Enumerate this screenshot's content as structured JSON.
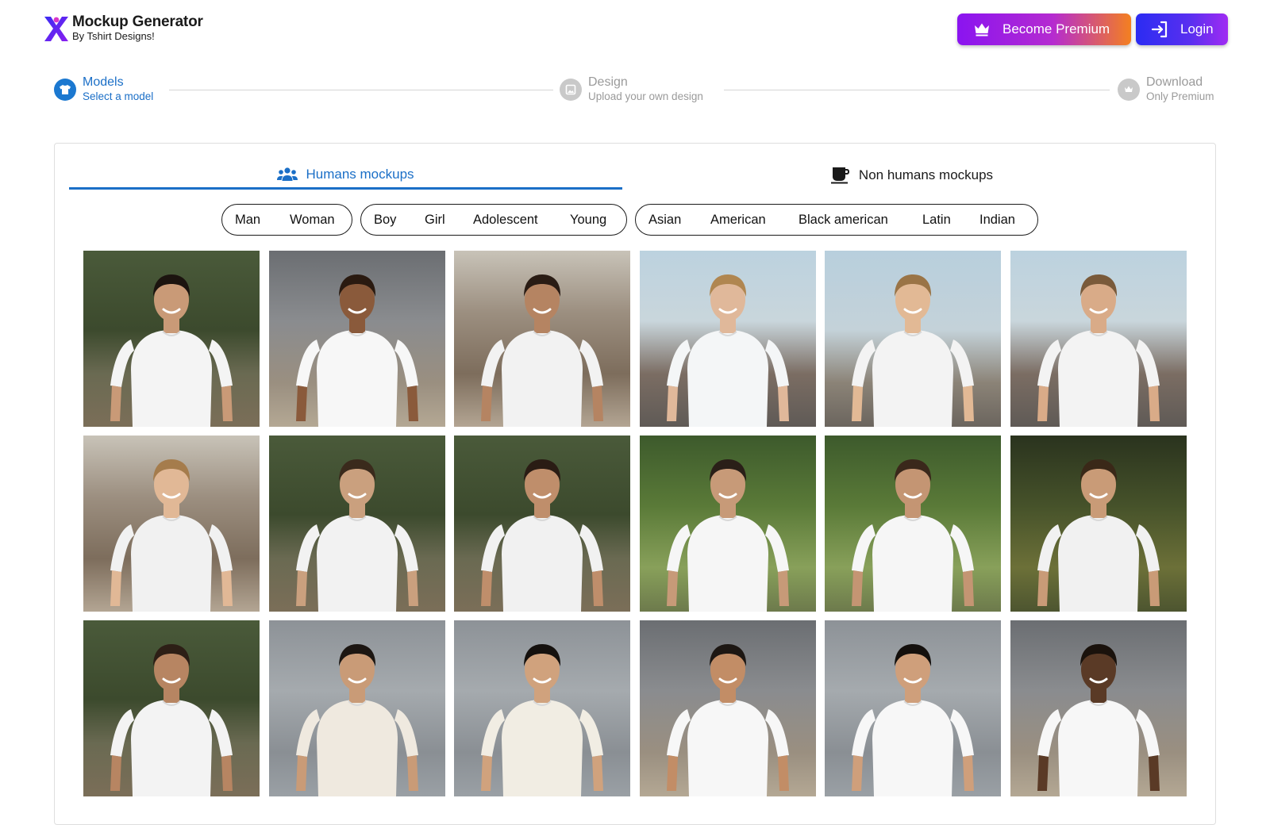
{
  "app": {
    "title": "Mockup Generator",
    "subtitle": "By Tshirt Designs!"
  },
  "header": {
    "premium_label": "Become Premium",
    "login_label": "Login",
    "premium_icon": "crown-icon",
    "login_icon": "login-icon"
  },
  "steps": [
    {
      "title": "Models",
      "subtitle": "Select a model",
      "state": "active",
      "icon": "shirt-icon"
    },
    {
      "title": "Design",
      "subtitle": "Upload your own design",
      "state": "inactive",
      "icon": "image-icon"
    },
    {
      "title": "Download",
      "subtitle": "Only Premium",
      "state": "inactive",
      "icon": "crown-icon"
    }
  ],
  "tabs": [
    {
      "label": "Humans mockups",
      "icon": "people-icon",
      "selected": true
    },
    {
      "label": "Non humans mockups",
      "icon": "mug-icon",
      "selected": false
    }
  ],
  "filters": {
    "gender": [
      "Man",
      "Woman"
    ],
    "age": [
      "Boy",
      "Girl",
      "Adolescent",
      "Young"
    ],
    "ethnicity": [
      "Asian",
      "American",
      "Black american",
      "Latin",
      "Indian"
    ]
  },
  "colors": {
    "accent": "#1b6fc7",
    "premium_start": "#8a14f0",
    "premium_end": "#f4801f",
    "login_start": "#2b2cf2",
    "login_end": "#a02bf2"
  },
  "thumbnails": [
    {
      "scene": "forest",
      "skin": "#c99a77",
      "hair": "#1c140f",
      "shirt": "#f4f4f4"
    },
    {
      "scene": "street",
      "skin": "#8a5a3b",
      "hair": "#2a1a10",
      "shirt": "#f7f7f7"
    },
    {
      "scene": "city",
      "skin": "#b58462",
      "hair": "#2a1c14",
      "shirt": "#f2f2f2"
    },
    {
      "scene": "sky-city",
      "skin": "#e0b89a",
      "hair": "#b08650",
      "shirt": "#f4f6f7"
    },
    {
      "scene": "balcony",
      "skin": "#e2b995",
      "hair": "#9a7446",
      "shirt": "#f3f3f3"
    },
    {
      "scene": "sky-city",
      "skin": "#d9ab88",
      "hair": "#7a5a3a",
      "shirt": "#f3f3f3"
    },
    {
      "scene": "city",
      "skin": "#e1b896",
      "hair": "#a57c4c",
      "shirt": "#f1f1f1"
    },
    {
      "scene": "forest",
      "skin": "#caa07e",
      "hair": "#3a2a1c",
      "shirt": "#f2f2f2"
    },
    {
      "scene": "forest",
      "skin": "#bf8e6b",
      "hair": "#2a1c14",
      "shirt": "#f1f1f1"
    },
    {
      "scene": "green",
      "skin": "#c79a78",
      "hair": "#2a1f18",
      "shirt": "#f6f6f6"
    },
    {
      "scene": "green",
      "skin": "#c49573",
      "hair": "#3a281b",
      "shirt": "#f6f6f6"
    },
    {
      "scene": "green-dark",
      "skin": "#c99b77",
      "hair": "#3a2818",
      "shirt": "#f1f1f1"
    },
    {
      "scene": "forest",
      "skin": "#b78562",
      "hair": "#2d1f16",
      "shirt": "#f3f3f3"
    },
    {
      "scene": "concrete",
      "skin": "#c99b77",
      "hair": "#1c1612",
      "shirt": "#efe9df"
    },
    {
      "scene": "concrete",
      "skin": "#d0a27d",
      "hair": "#15110e",
      "shirt": "#f1ede3"
    },
    {
      "scene": "street",
      "skin": "#c28d66",
      "hair": "#1d1713",
      "shirt": "#f7f7f7"
    },
    {
      "scene": "concrete",
      "skin": "#cf9f7b",
      "hair": "#14100d",
      "shirt": "#f7f7f7"
    },
    {
      "scene": "street",
      "skin": "#5a3a26",
      "hair": "#1a120c",
      "shirt": "#f7f7f7"
    }
  ]
}
